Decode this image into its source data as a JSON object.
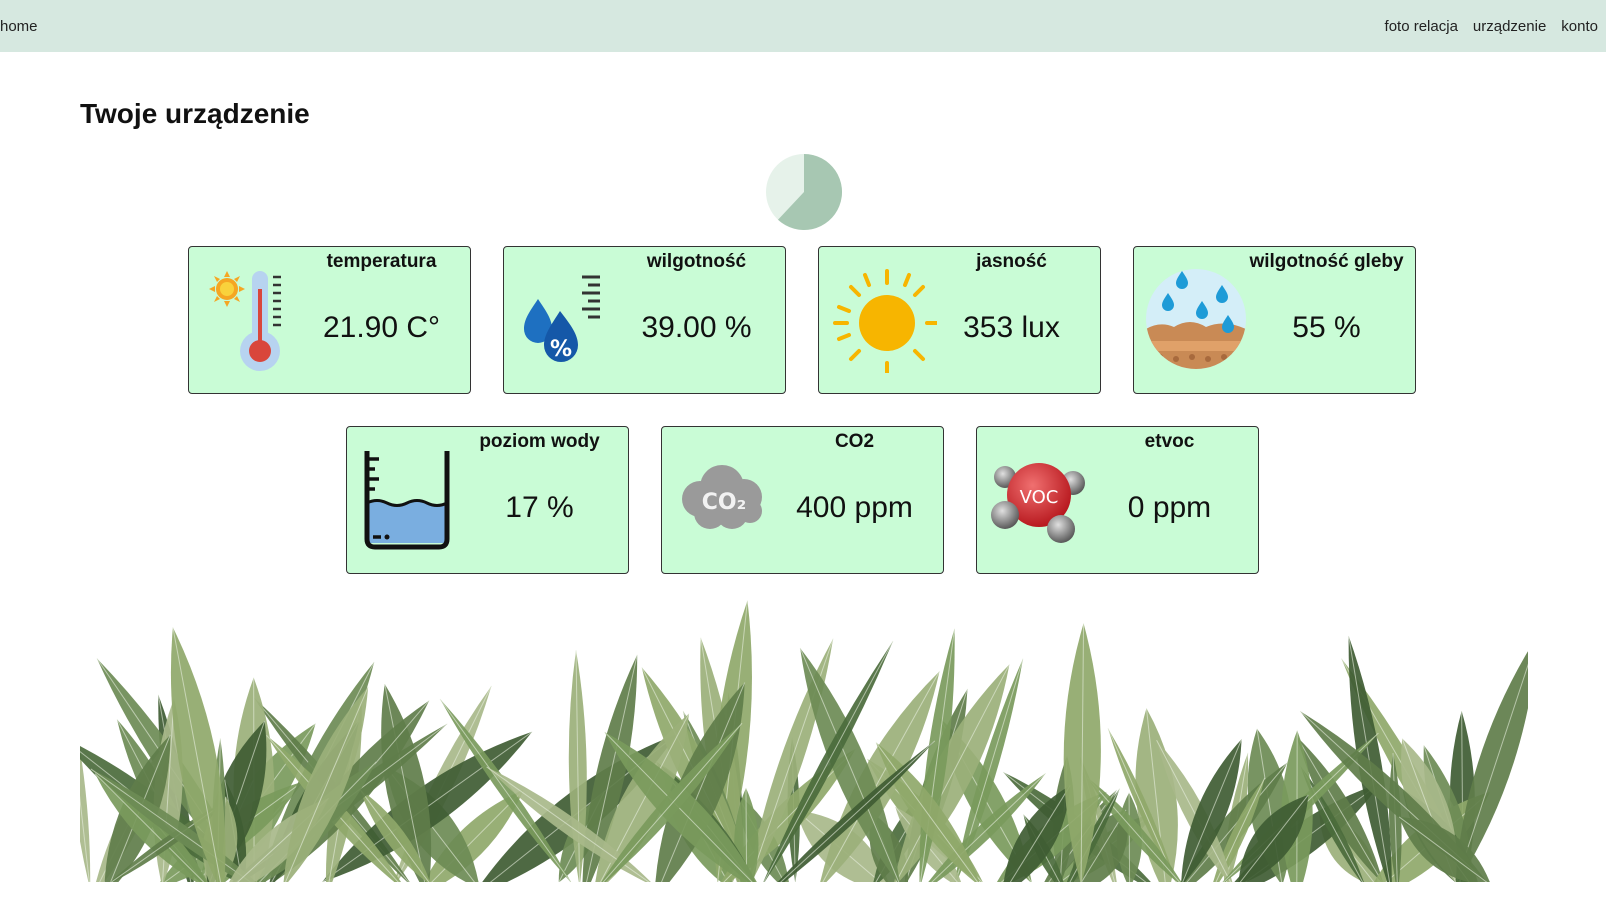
{
  "nav": {
    "home": "home",
    "links": [
      "foto relacja",
      "urządzenie",
      "konto"
    ]
  },
  "page": {
    "title": "Twoje urządzenie"
  },
  "progress": {
    "fraction": 0.62
  },
  "cards": [
    {
      "label": "temperatura",
      "value": "21.90 C°",
      "icon": "thermometer-icon"
    },
    {
      "label": "wilgotność",
      "value": "39.00 %",
      "icon": "humidity-icon"
    },
    {
      "label": "jasność",
      "value": "353 lux",
      "icon": "sun-icon"
    },
    {
      "label": "wilgotność gleby",
      "value": "55 %",
      "icon": "soil-moisture-icon"
    },
    {
      "label": "poziom wody",
      "value": "17 %",
      "icon": "water-level-icon"
    },
    {
      "label": "CO2",
      "value": "400 ppm",
      "icon": "co2-cloud-icon",
      "icon_text": "CO₂"
    },
    {
      "label": "etvoc",
      "value": "0 ppm",
      "icon": "voc-molecule-icon",
      "icon_text": "VOC"
    }
  ],
  "colors": {
    "navbar": "#d6e8e0",
    "card_bg": "#c9fcd6",
    "card_border": "#333333",
    "pie_light": "#e6f2ea",
    "pie_dark": "#a7c7b2"
  }
}
